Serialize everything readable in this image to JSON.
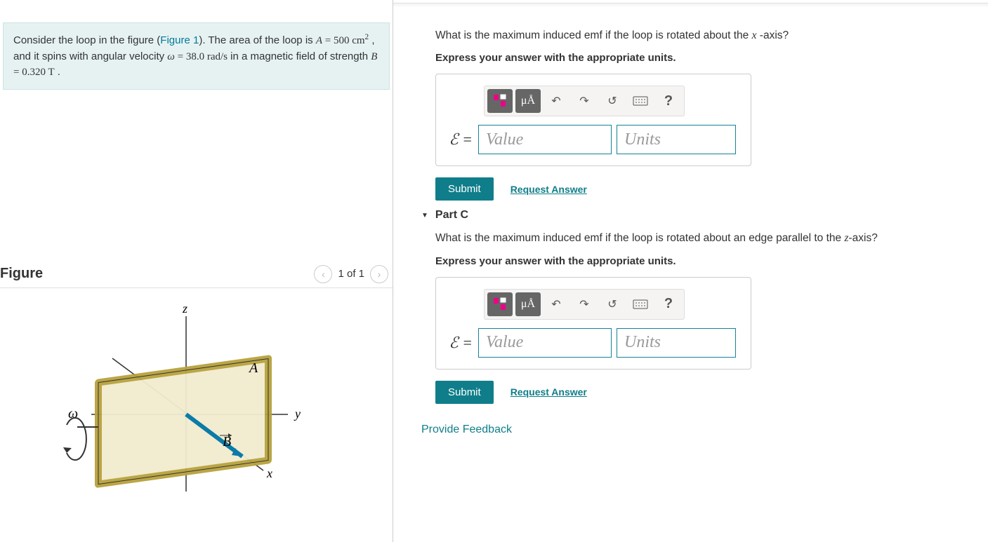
{
  "problem": {
    "text1": "Consider the loop in the figure (",
    "figlink": "Figure 1",
    "text2": "). The area of the loop is ",
    "area_var": "A",
    "area_eq": " = 500 ",
    "area_unit": "cm",
    "area_exp": "2",
    "text3": " , and it spins with angular velocity ",
    "omega": "ω",
    "omega_eq": " = 38.0 ",
    "omega_unit": "rad/s",
    "text4": " in a magnetic field of strength ",
    "B": "B",
    "B_eq": " = 0.320 ",
    "B_unit": "T",
    "text5": " ."
  },
  "figure": {
    "heading": "Figure",
    "nav": "1 of 1",
    "labels": {
      "z": "z",
      "y": "y",
      "x": "x",
      "A": "A",
      "B": "B",
      "omega": "ω"
    }
  },
  "parts": [
    {
      "q1": "What is the maximum induced emf if the loop is rotated about the ",
      "var": "x",
      "q2": " -axis?",
      "instr": "Express your answer with the appropriate units.",
      "symbol": "ℰ =",
      "value_ph": "Value",
      "units_ph": "Units",
      "ua": "μÅ",
      "submit": "Submit",
      "request": "Request Answer"
    },
    {
      "title": "Part C",
      "q1": "What is the maximum induced emf if the loop is rotated about an edge parallel to the ",
      "var": "z",
      "q2": "-axis?",
      "instr": "Express your answer with the appropriate units.",
      "symbol": "ℰ =",
      "value_ph": "Value",
      "units_ph": "Units",
      "ua": "μÅ",
      "submit": "Submit",
      "request": "Request Answer"
    }
  ],
  "feedback": "Provide Feedback"
}
